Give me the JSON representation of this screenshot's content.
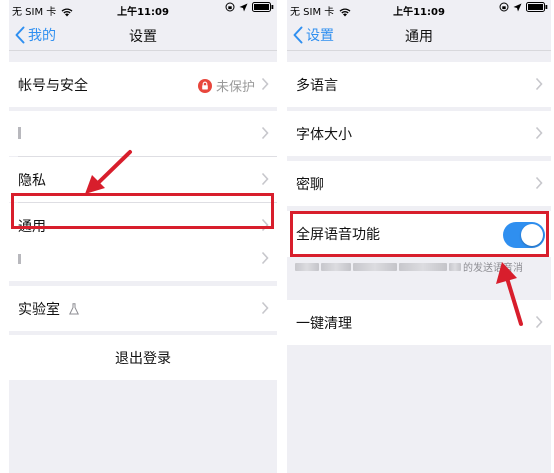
{
  "status_bar": {
    "carrier": "无 SIM 卡",
    "time": "上午11:09"
  },
  "screen1": {
    "nav": {
      "back_label": "我的",
      "title": "设置"
    },
    "rows": {
      "account": {
        "label": "帐号与安全",
        "status": "未保护"
      },
      "row2": {
        "label": ""
      },
      "privacy": {
        "label": "隐私"
      },
      "general": {
        "label": "通用"
      },
      "row5": {
        "label": ""
      },
      "lab": {
        "label": "实验室"
      }
    },
    "logout_label": "退出登录"
  },
  "screen2": {
    "nav": {
      "back_label": "设置",
      "title": "通用"
    },
    "rows": {
      "language": {
        "label": "多语言"
      },
      "font_size": {
        "label": "字体大小"
      },
      "secret_chat": {
        "label": "密聊"
      },
      "fullscreen_voice": {
        "label": "全屏语音功能",
        "enabled": true
      },
      "one_click_clean": {
        "label": "一键清理"
      }
    },
    "voice_desc_tail": "的发送语音消"
  },
  "colors": {
    "accent_blue": "#2f8ff0",
    "highlight_red": "#d81e2c",
    "background": "#efeff4"
  }
}
